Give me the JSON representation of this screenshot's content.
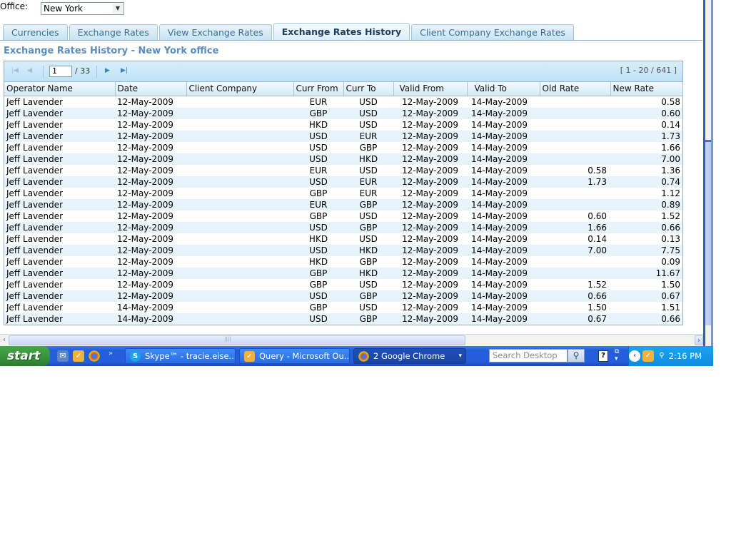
{
  "office": {
    "label": "Office:",
    "selected": "New York"
  },
  "tabs": [
    {
      "label": "Currencies",
      "active": false
    },
    {
      "label": "Exchange Rates",
      "active": false
    },
    {
      "label": "View Exchange Rates",
      "active": false
    },
    {
      "label": "Exchange Rates History",
      "active": true
    },
    {
      "label": "Client Company Exchange Rates",
      "active": false
    }
  ],
  "section_title": "Exchange Rates History - New York office",
  "pager": {
    "current_page": "1",
    "total_pages": "/ 33",
    "range": "[ 1 - 20 / 641 ]",
    "icons": {
      "first": "first-page-icon",
      "prev": "prev-page-icon",
      "next": "next-page-icon",
      "last": "last-page-icon"
    }
  },
  "table": {
    "columns": [
      "Operator Name",
      "Date",
      "Client Company",
      "Curr From",
      "Curr To",
      "Valid From",
      "Valid To",
      "Old Rate",
      "New Rate"
    ],
    "rows": [
      [
        "Jeff Lavender",
        "12-May-2009",
        "",
        "EUR",
        "USD",
        "12-May-2009",
        "14-May-2009",
        "",
        "0.58"
      ],
      [
        "Jeff Lavender",
        "12-May-2009",
        "",
        "GBP",
        "USD",
        "12-May-2009",
        "14-May-2009",
        "",
        "0.60"
      ],
      [
        "Jeff Lavender",
        "12-May-2009",
        "",
        "HKD",
        "USD",
        "12-May-2009",
        "14-May-2009",
        "",
        "0.14"
      ],
      [
        "Jeff Lavender",
        "12-May-2009",
        "",
        "USD",
        "EUR",
        "12-May-2009",
        "14-May-2009",
        "",
        "1.73"
      ],
      [
        "Jeff Lavender",
        "12-May-2009",
        "",
        "USD",
        "GBP",
        "12-May-2009",
        "14-May-2009",
        "",
        "1.66"
      ],
      [
        "Jeff Lavender",
        "12-May-2009",
        "",
        "USD",
        "HKD",
        "12-May-2009",
        "14-May-2009",
        "",
        "7.00"
      ],
      [
        "Jeff Lavender",
        "12-May-2009",
        "",
        "EUR",
        "USD",
        "12-May-2009",
        "14-May-2009",
        "0.58",
        "1.36"
      ],
      [
        "Jeff Lavender",
        "12-May-2009",
        "",
        "USD",
        "EUR",
        "12-May-2009",
        "14-May-2009",
        "1.73",
        "0.74"
      ],
      [
        "Jeff Lavender",
        "12-May-2009",
        "",
        "GBP",
        "EUR",
        "12-May-2009",
        "14-May-2009",
        "",
        "1.12"
      ],
      [
        "Jeff Lavender",
        "12-May-2009",
        "",
        "EUR",
        "GBP",
        "12-May-2009",
        "14-May-2009",
        "",
        "0.89"
      ],
      [
        "Jeff Lavender",
        "12-May-2009",
        "",
        "GBP",
        "USD",
        "12-May-2009",
        "14-May-2009",
        "0.60",
        "1.52"
      ],
      [
        "Jeff Lavender",
        "12-May-2009",
        "",
        "USD",
        "GBP",
        "12-May-2009",
        "14-May-2009",
        "1.66",
        "0.66"
      ],
      [
        "Jeff Lavender",
        "12-May-2009",
        "",
        "HKD",
        "USD",
        "12-May-2009",
        "14-May-2009",
        "0.14",
        "0.13"
      ],
      [
        "Jeff Lavender",
        "12-May-2009",
        "",
        "USD",
        "HKD",
        "12-May-2009",
        "14-May-2009",
        "7.00",
        "7.75"
      ],
      [
        "Jeff Lavender",
        "12-May-2009",
        "",
        "HKD",
        "GBP",
        "12-May-2009",
        "14-May-2009",
        "",
        "0.09"
      ],
      [
        "Jeff Lavender",
        "12-May-2009",
        "",
        "GBP",
        "HKD",
        "12-May-2009",
        "14-May-2009",
        "",
        "11.67"
      ],
      [
        "Jeff Lavender",
        "12-May-2009",
        "",
        "GBP",
        "USD",
        "12-May-2009",
        "14-May-2009",
        "1.52",
        "1.50"
      ],
      [
        "Jeff Lavender",
        "12-May-2009",
        "",
        "USD",
        "GBP",
        "12-May-2009",
        "14-May-2009",
        "0.66",
        "0.67"
      ],
      [
        "Jeff Lavender",
        "14-May-2009",
        "",
        "GBP",
        "USD",
        "12-May-2009",
        "14-May-2009",
        "1.50",
        "1.51"
      ],
      [
        "Jeff Lavender",
        "14-May-2009",
        "",
        "USD",
        "GBP",
        "12-May-2009",
        "14-May-2009",
        "0.67",
        "0.66"
      ]
    ]
  },
  "taskbar": {
    "start_label": "start",
    "quick_launch": [
      "outlook-express-icon",
      "outlook-icon",
      "chrome-icon"
    ],
    "more_label": "»",
    "buttons": [
      {
        "label": "Skype™ - tracie.eise...",
        "icon": "skype-icon",
        "active": false
      },
      {
        "label": "Query - Microsoft Ou...",
        "icon": "outlook-icon",
        "active": false
      },
      {
        "label": "2 Google Chrome",
        "icon": "chrome-icon",
        "active": true,
        "dropdown": "▾"
      }
    ],
    "search_placeholder": "Search Desktop",
    "clock": "2:16 PM"
  },
  "colors": {
    "accent": "#5b8dbd",
    "row_alt": "#e8f4fb",
    "taskbar": "#245edb",
    "start": "#37913a",
    "tray": "#0f8ce0"
  }
}
